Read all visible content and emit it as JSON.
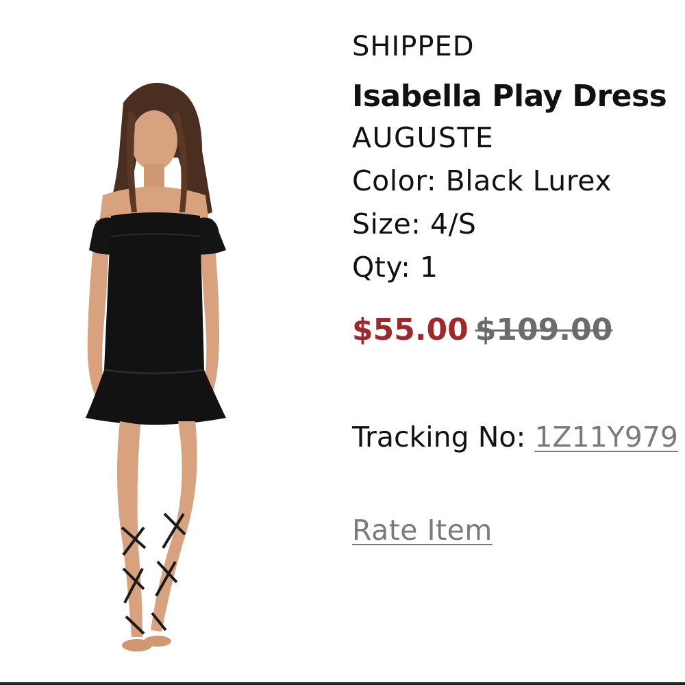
{
  "order_item": {
    "status": "SHIPPED",
    "product_name": "Isabella Play Dress",
    "brand": "AUGUSTE",
    "color_line": "Color: Black Lurex",
    "size_line": "Size: 4/S",
    "qty_line": "Qty: 1",
    "sale_price": "$55.00",
    "original_price": "$109.00",
    "tracking_label": "Tracking No: ",
    "tracking_number": "1Z11Y979",
    "rate_label": "Rate Item",
    "image_icon": "product-photo-dress"
  },
  "colors": {
    "sale_price": "#a0282b",
    "original_price": "#6b6b6b",
    "link": "#7a7a7a",
    "dress": "#111111",
    "skin": "#d8a27e",
    "hair": "#4a2e1f"
  }
}
